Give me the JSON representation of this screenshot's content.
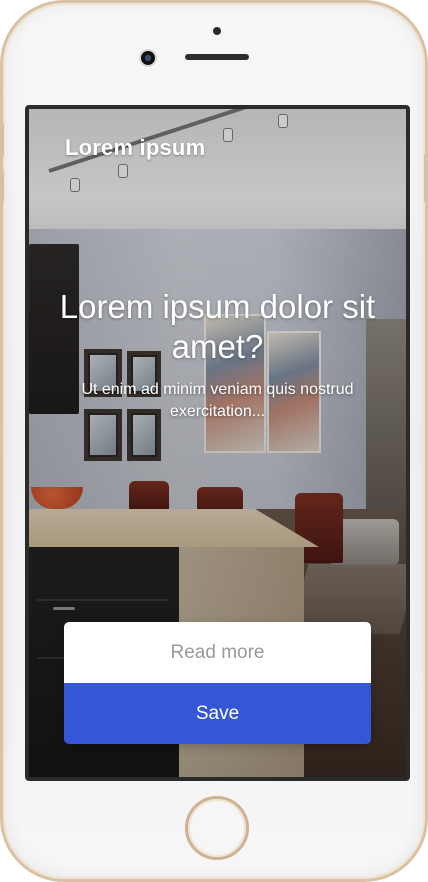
{
  "app": {
    "brand": "Lorem ipsum"
  },
  "hero": {
    "headline": "Lorem ipsum dolor sit amet?",
    "subline": "Ut enim ad minim veniam quis nostrud exercitation..."
  },
  "actions": {
    "read_more_label": "Read more",
    "save_label": "Save"
  },
  "colors": {
    "primary": "#3556d6",
    "secondary_button_bg": "#ffffff",
    "secondary_button_text": "#9a9a9a",
    "phone_frame": "#d9c2a3"
  },
  "icons": {
    "device": "phone-frame",
    "home_button": "home-button",
    "camera": "front-camera",
    "speaker": "earpiece-speaker"
  }
}
